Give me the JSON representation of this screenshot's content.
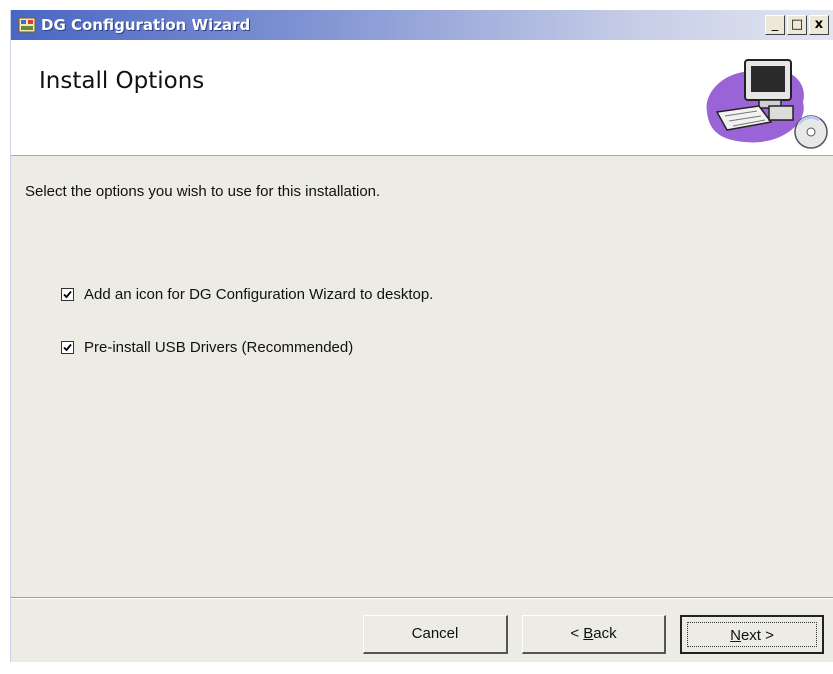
{
  "window": {
    "title": "DG Configuration Wizard",
    "controls": {
      "minimize": "_",
      "maximize": "□",
      "close": "x"
    }
  },
  "header": {
    "title": "Install Options",
    "art_icon": "computer-cd-icon"
  },
  "instruction": "Select the options you wish to use for this installation.",
  "options": [
    {
      "label": "Add an icon for DG Configuration Wizard to desktop.",
      "checked": true
    },
    {
      "label": "Pre-install USB Drivers (Recommended)",
      "checked": true
    }
  ],
  "buttons": {
    "cancel": "Cancel",
    "back_prefix": "< ",
    "back_mnemonic": "B",
    "back_rest": "ack",
    "next_mnemonic": "N",
    "next_rest": "ext >"
  },
  "colors": {
    "titlebar_start": "#4a66c4",
    "titlebar_end": "#e3e6f1",
    "dialog_bg": "#ecebe4"
  }
}
